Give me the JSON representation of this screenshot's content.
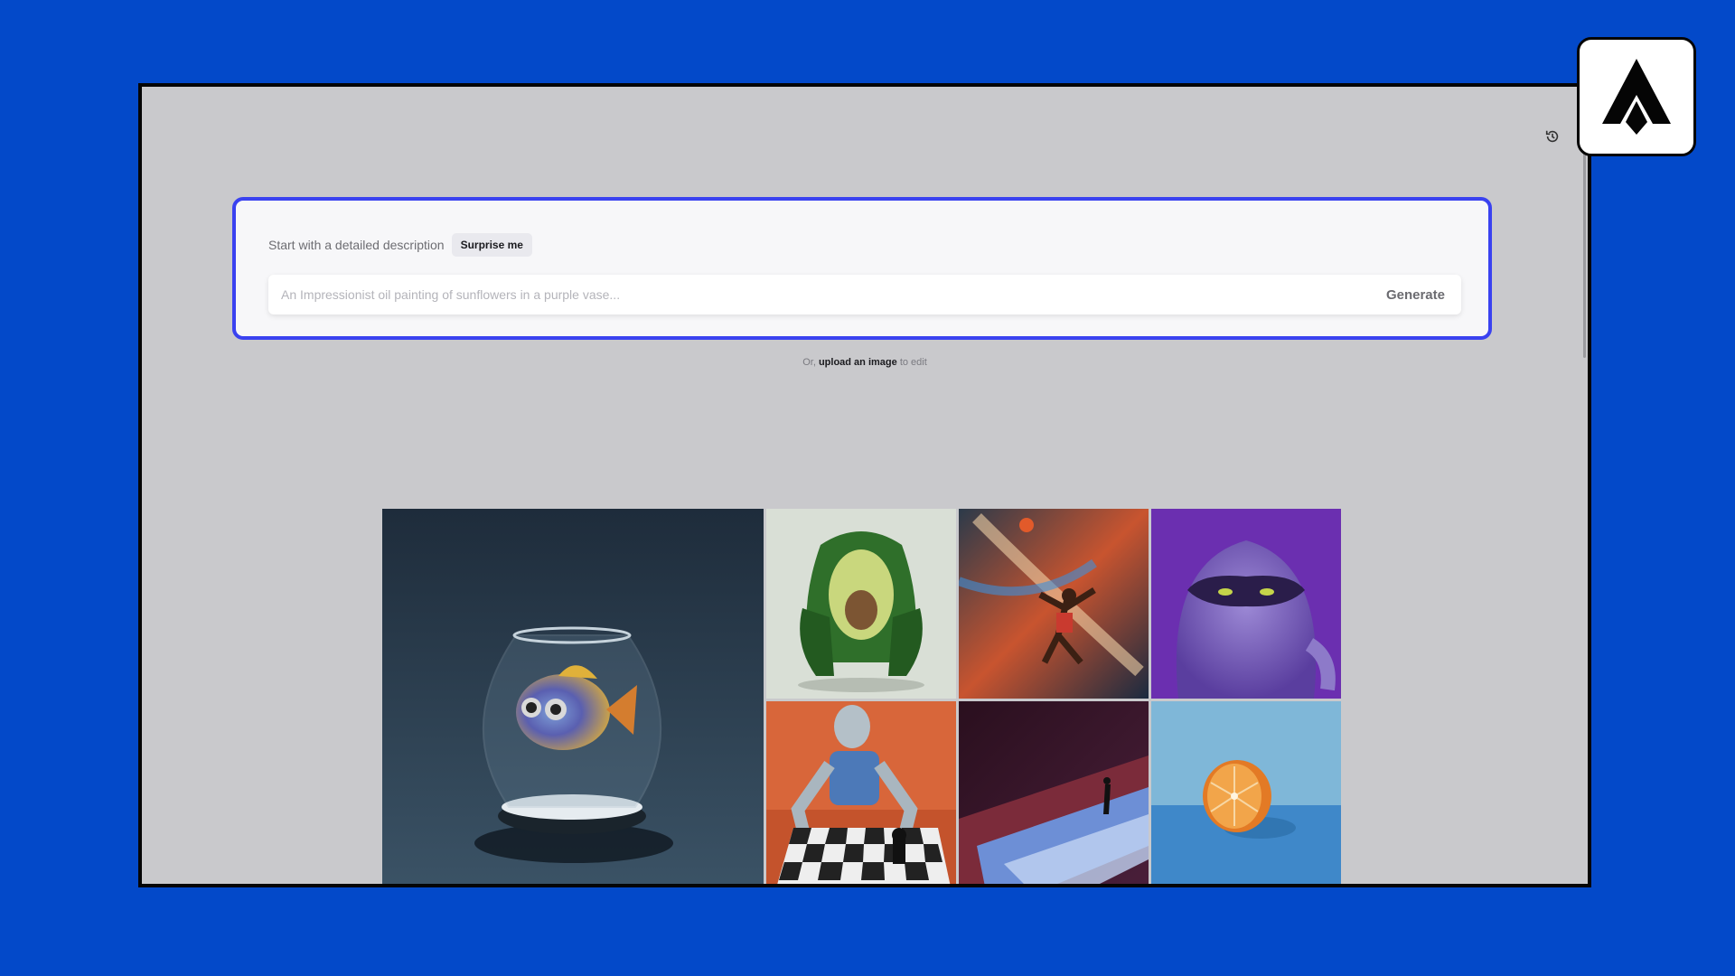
{
  "prompt": {
    "title": "Start with a detailed description",
    "surprise_label": "Surprise me",
    "placeholder": "An Impressionist oil painting of sunflowers in a purple vase...",
    "generate_label": "Generate"
  },
  "upload": {
    "prefix": "Or,",
    "link": "upload an image",
    "suffix": "to edit"
  },
  "colors": {
    "background": "#0349c9",
    "window": "#c9c9cc",
    "prompt_border": "#3a42f0"
  },
  "icons": {
    "history": "history-icon",
    "logo": "logo-icon"
  }
}
